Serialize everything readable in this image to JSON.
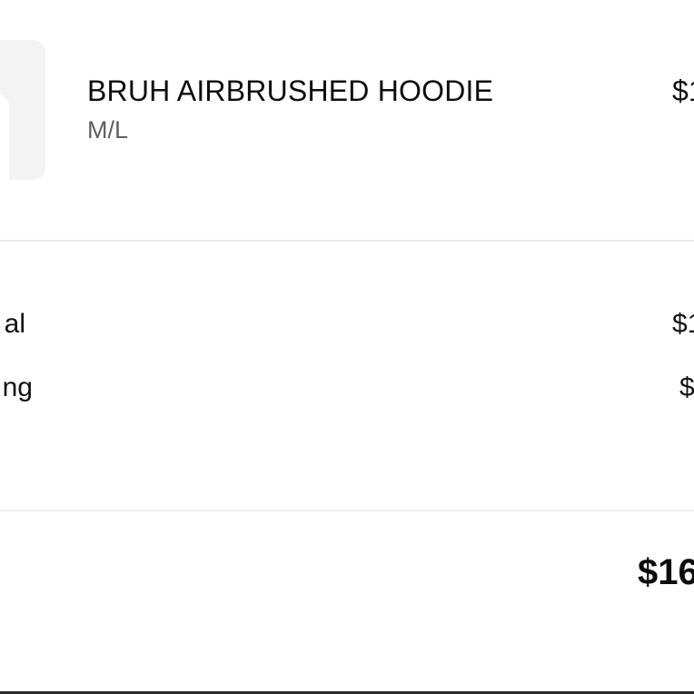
{
  "item": {
    "image_alt": "hoodie-thumbnail",
    "name": "BRUH AIRBRUSHED HOODIE",
    "variant": "M/L",
    "price": "$1"
  },
  "summary": {
    "subtotal_label": "al",
    "subtotal_value": "$1",
    "shipping_label": "ng",
    "shipping_value": "$"
  },
  "total": {
    "value": "$16"
  },
  "colors": {
    "background": "#ffffff",
    "text": "#111111",
    "muted_text": "#5f5f5f",
    "divider": "#ececec",
    "thumbnail_bg": "#f3f3f3"
  }
}
